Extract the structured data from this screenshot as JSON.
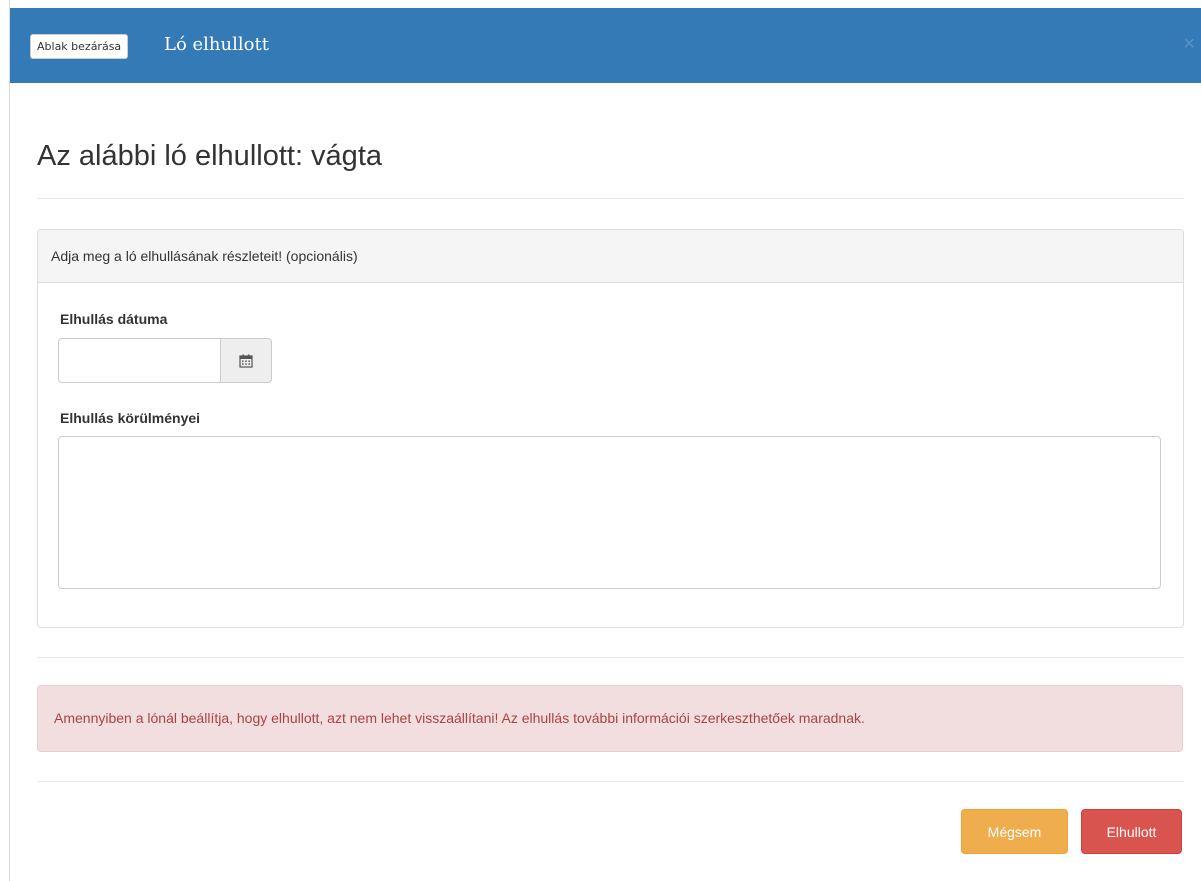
{
  "modal": {
    "close_window_label": "Ablak bezárása",
    "title": "Ló elhullott",
    "close_symbol": "×"
  },
  "main": {
    "heading": "Az alábbi ló elhullott: vágta"
  },
  "panel": {
    "heading": "Adja meg a ló elhullásának részleteit! (opcionális)",
    "date_label": "Elhullás dátuma",
    "date_value": "",
    "date_icon": "calendar-icon",
    "circumstances_label": "Elhullás körülményei",
    "circumstances_value": ""
  },
  "alert": {
    "text": "Amennyiben a lónál beállítja, hogy elhullott, azt nem lehet visszaállítani! Az elhullás további információi szerkeszthetőek maradnak."
  },
  "footer": {
    "cancel_label": "Mégsem",
    "confirm_label": "Elhullott"
  },
  "colors": {
    "header": "#337ab7",
    "warning_button": "#f0ad4e",
    "danger_button": "#d9534f",
    "alert_background": "#f2dede",
    "alert_text": "#a94442"
  }
}
